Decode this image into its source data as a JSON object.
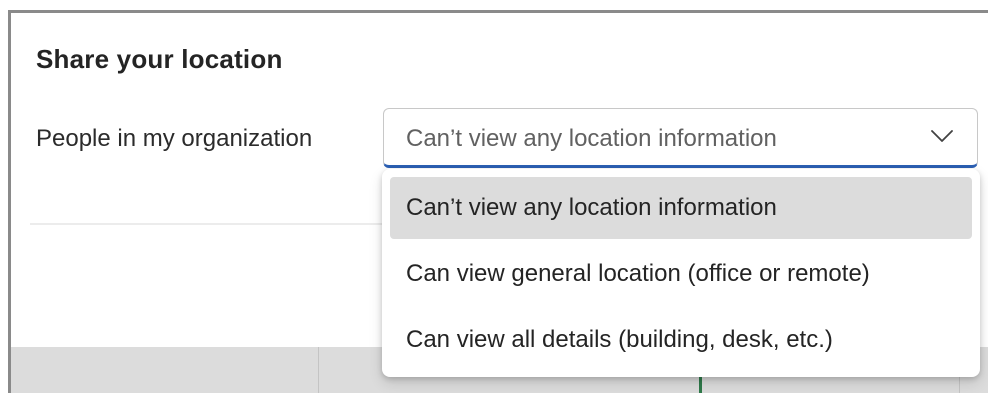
{
  "dialog": {
    "title": "Share your location"
  },
  "field": {
    "label": "People in my organization",
    "selected_value": "Can’t view any location information",
    "chevron_icon": "chevron-down-icon",
    "focus_color": "#2b5fb3"
  },
  "dropdown": {
    "options": [
      {
        "label": "Can’t view any location information",
        "selected": true
      },
      {
        "label": "Can view general location (office or remote)",
        "selected": false
      },
      {
        "label": "Can view all details (building, desk, etc.)",
        "selected": false
      }
    ],
    "selected_background": "#dcdcdc"
  }
}
